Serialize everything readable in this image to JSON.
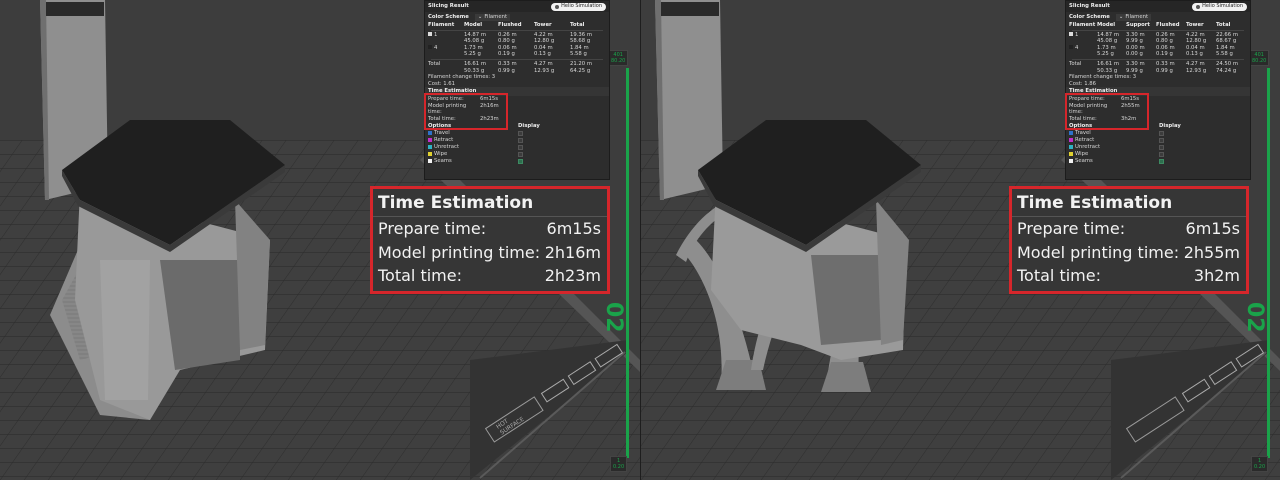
{
  "colors": {
    "highlight": "#d6262b",
    "slider": "#1aa34a",
    "panel_bg": "#2d2d2d",
    "bed": "#3a3a3a",
    "model": "#8a8a8a",
    "top_surface": "#1e1e1e",
    "travel": "#2e72c9",
    "retract": "#c22ec9",
    "unretract": "#2fb3c4",
    "wipe": "#e0d130",
    "seams": "#f2f2f2"
  },
  "left": {
    "panel": {
      "title": "Slicing Result",
      "helio_label": "Helio Simulation",
      "color_scheme_label": "Color Scheme",
      "color_scheme_value": "Filament",
      "headers": [
        "Filament",
        "Model",
        "Flushed",
        "Tower",
        "Total"
      ],
      "rows": [
        {
          "id": "1",
          "model": "14.87 m",
          "model_g": "45.08 g",
          "flushed": "0.26 m",
          "flushed_g": "0.80 g",
          "tower": "4.22 m",
          "tower_g": "12.80 g",
          "total": "19.36 m",
          "total_g": "58.68 g"
        },
        {
          "id": "4",
          "model": "1.73 m",
          "model_g": "5.25 g",
          "flushed": "0.06 m",
          "flushed_g": "0.19 g",
          "tower": "0.04 m",
          "tower_g": "0.13 g",
          "total": "1.84 m",
          "total_g": "5.58 g"
        }
      ],
      "total_row": {
        "label": "Total",
        "model": "16.61 m",
        "model_g": "50.33 g",
        "flushed": "0.33 m",
        "flushed_g": "0.99 g",
        "tower": "4.27 m",
        "tower_g": "12.93 g",
        "total": "21.20 m",
        "total_g": "64.25 g"
      },
      "filament_change": "Filament change times: 3",
      "cost": "Cost: 1.61",
      "time_title": "Time Estimation",
      "prepare_label": "Prepare time:",
      "prepare_value": "6m15s",
      "model_time_label": "Model printing time:",
      "model_time_value": "2h16m",
      "total_label": "Total time:",
      "total_value": "2h23m",
      "options_label": "Options",
      "display_label": "Display",
      "options": [
        "Travel",
        "Retract",
        "Unretract",
        "Wipe",
        "Seams"
      ]
    },
    "callout": {
      "title": "Time Estimation",
      "prepare_label": "Prepare time:",
      "prepare_value": "6m15s",
      "model_label": "Model printing time:",
      "model_value": "2h16m",
      "total_label": "Total time:",
      "total_value": "2h23m"
    },
    "slider": {
      "top_layer": "401",
      "top_height": "80.20",
      "bottom_layer": "1",
      "bottom_height": "0.20"
    }
  },
  "right": {
    "panel": {
      "title": "Slicing Result",
      "helio_label": "Helio Simulation",
      "color_scheme_label": "Color Scheme",
      "color_scheme_value": "Filament",
      "headers": [
        "Filament",
        "Model",
        "Support",
        "Flushed",
        "Tower",
        "Total"
      ],
      "rows": [
        {
          "id": "1",
          "model": "14.87 m",
          "model_g": "45.08 g",
          "support": "3.30 m",
          "support_g": "9.99 g",
          "flushed": "0.26 m",
          "flushed_g": "0.80 g",
          "tower": "4.22 m",
          "tower_g": "12.80 g",
          "total": "22.66 m",
          "total_g": "68.67 g"
        },
        {
          "id": "4",
          "model": "1.73 m",
          "model_g": "5.25 g",
          "support": "0.00 m",
          "support_g": "0.00 g",
          "flushed": "0.06 m",
          "flushed_g": "0.19 g",
          "tower": "0.04 m",
          "tower_g": "0.13 g",
          "total": "1.84 m",
          "total_g": "5.58 g"
        }
      ],
      "total_row": {
        "label": "Total",
        "model": "16.61 m",
        "model_g": "50.33 g",
        "support": "3.30 m",
        "support_g": "9.99 g",
        "flushed": "0.33 m",
        "flushed_g": "0.99 g",
        "tower": "4.27 m",
        "tower_g": "12.93 g",
        "total": "24.50 m",
        "total_g": "74.24 g"
      },
      "filament_change": "Filament change times: 3",
      "cost": "Cost: 1.86",
      "time_title": "Time Estimation",
      "prepare_label": "Prepare time:",
      "prepare_value": "6m15s",
      "model_time_label": "Model printing time:",
      "model_time_value": "2h55m",
      "total_label": "Total time:",
      "total_value": "3h2m",
      "options_label": "Options",
      "display_label": "Display",
      "options": [
        "Travel",
        "Retract",
        "Unretract",
        "Wipe",
        "Seams"
      ]
    },
    "callout": {
      "title": "Time Estimation",
      "prepare_label": "Prepare time:",
      "prepare_value": "6m15s",
      "model_label": "Model printing time:",
      "model_value": "2h55m",
      "total_label": "Total time:",
      "total_value": "3h2m"
    },
    "slider": {
      "top_layer": "401",
      "top_height": "80.20",
      "bottom_layer": "1",
      "bottom_height": "0.20"
    }
  },
  "bed_text": {
    "hot": "HOT",
    "surface": "SURFACE",
    "badge": "02"
  }
}
